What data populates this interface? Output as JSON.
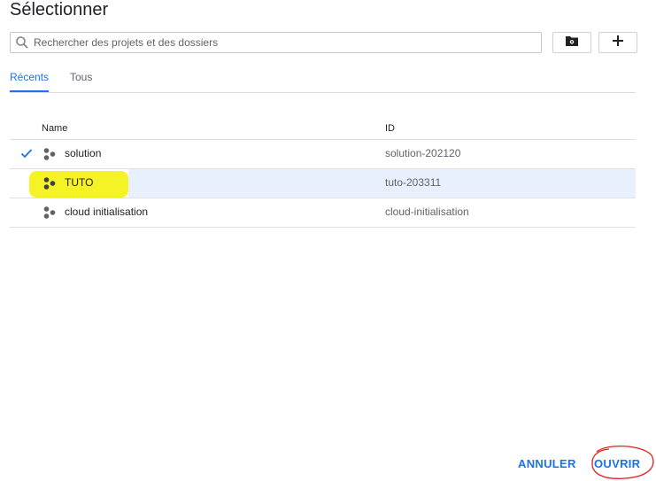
{
  "dialog": {
    "title": "Sélectionner"
  },
  "search": {
    "placeholder": "Rechercher des projets et des dossiers"
  },
  "actions": {
    "new_folder_icon": "folder-settings-icon",
    "add_icon": "plus-icon"
  },
  "tabs": [
    {
      "label": "Récents",
      "active": true
    },
    {
      "label": "Tous",
      "active": false
    }
  ],
  "table": {
    "columns": {
      "name": "Name",
      "id": "ID"
    },
    "rows": [
      {
        "name": "solution",
        "id": "solution-202120",
        "checked": true
      },
      {
        "name": "TUTO",
        "id": "tuto-203311",
        "selected": true
      },
      {
        "name": "cloud initialisation",
        "id": "cloud-initialisation"
      }
    ]
  },
  "footer": {
    "cancel_label": "ANNULER",
    "open_label": "OUVRIR"
  },
  "colors": {
    "accent": "#1a73e8",
    "highlight": "#f3f000",
    "annotation": "#e02020"
  }
}
